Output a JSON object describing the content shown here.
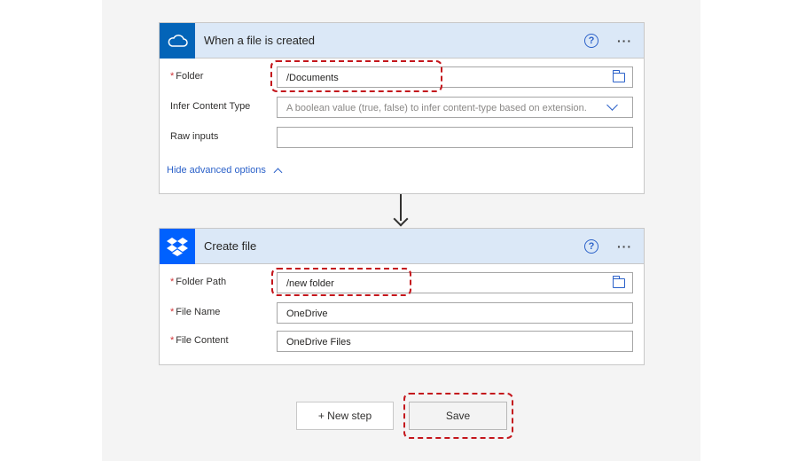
{
  "trigger": {
    "title": "When a file is created",
    "icon": "onedrive-cloud-icon",
    "fields": {
      "folder": {
        "label": "Folder",
        "value": "/Documents"
      },
      "infer_content_type": {
        "label": "Infer Content Type",
        "placeholder": "A boolean value (true, false) to infer content-type based on extension."
      },
      "raw_inputs": {
        "label": "Raw inputs",
        "value": ""
      }
    },
    "advanced_link": "Hide advanced options"
  },
  "action": {
    "title": "Create file",
    "icon": "dropbox-icon",
    "fields": {
      "folder_path": {
        "label": "Folder Path",
        "value": "/new folder"
      },
      "file_name": {
        "label": "File Name",
        "value": "OneDrive"
      },
      "file_content": {
        "label": "File Content",
        "value": "OneDrive Files"
      }
    }
  },
  "buttons": {
    "new_step": "+ New step",
    "save": "Save"
  },
  "colors": {
    "header_bg": "#dbe8f7",
    "link_blue": "#2b61c9",
    "required_red": "#d13438",
    "highlight_red": "#c4161c"
  }
}
